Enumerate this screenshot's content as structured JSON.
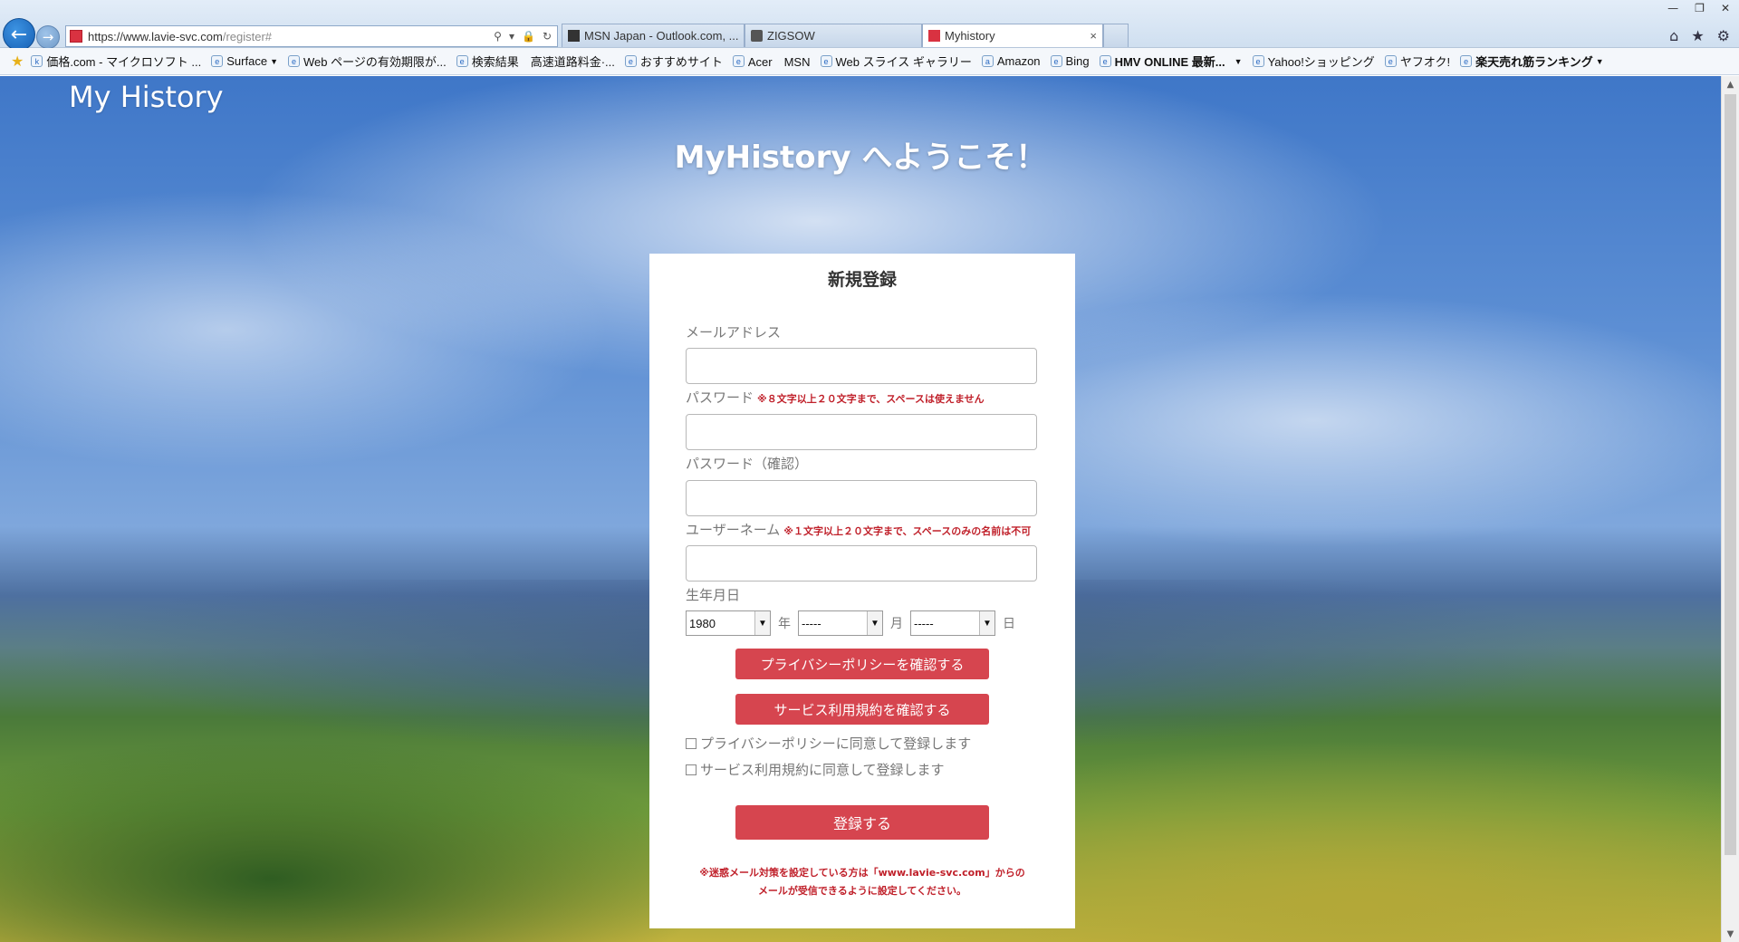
{
  "browser": {
    "url_base": "https://www.lavie-svc.com",
    "url_path": "/register#",
    "tabs": [
      {
        "title": "MSN Japan - Outlook.com, ..."
      },
      {
        "title": "ZIGSOW"
      },
      {
        "title": "Myhistory",
        "close": "×"
      }
    ],
    "favorites": [
      {
        "label": "価格.com - マイクロソフト ..."
      },
      {
        "label": "Surface"
      },
      {
        "label": "Web ページの有効期限が..."
      },
      {
        "label": "検索結果　高速道路料金·..."
      },
      {
        "label": "おすすめサイト"
      },
      {
        "label": "Acer　MSN"
      },
      {
        "label": "Web スライス ギャラリー"
      },
      {
        "label": "Amazon"
      },
      {
        "label": "Bing"
      },
      {
        "label": "HMV ONLINE 最新..."
      },
      {
        "label": "Yahoo!ショッピング"
      },
      {
        "label": "ヤフオク!"
      },
      {
        "label": "楽天売れ筋ランキング"
      }
    ],
    "accent": "#1b64b6"
  },
  "site": {
    "logo": "My History",
    "welcome": "MyHistory へようこそ！"
  },
  "form": {
    "title": "新規登録",
    "email_label": "メールアドレス",
    "email_value": "",
    "password_label": "パスワード",
    "password_note": "※８文字以上２０文字まで、スペースは使えません",
    "password_value": "",
    "password_confirm_label": "パスワード（確認）",
    "password_confirm_value": "",
    "username_label": "ユーザーネーム",
    "username_note": "※１文字以上２０文字まで、スペースのみの名前は不可",
    "username_value": "",
    "birthdate_label": "生年月日",
    "year_value": "1980",
    "year_unit": "年",
    "month_value": "-----",
    "month_unit": "月",
    "day_value": "-----",
    "day_unit": "日",
    "privacy_button": "プライバシーポリシーを確認する",
    "terms_button": "サービス利用規約を確認する",
    "privacy_agree": "プライバシーポリシーに同意して登録します",
    "terms_agree": "サービス利用規約に同意して登録します",
    "submit": "登録する",
    "notice_line1": "※迷惑メール対策を設定している方は「www.lavie-svc.com」からの",
    "notice_line2": "メールが受信できるように設定してください。",
    "button_color": "#d6454f",
    "note_color": "#c0202a"
  }
}
